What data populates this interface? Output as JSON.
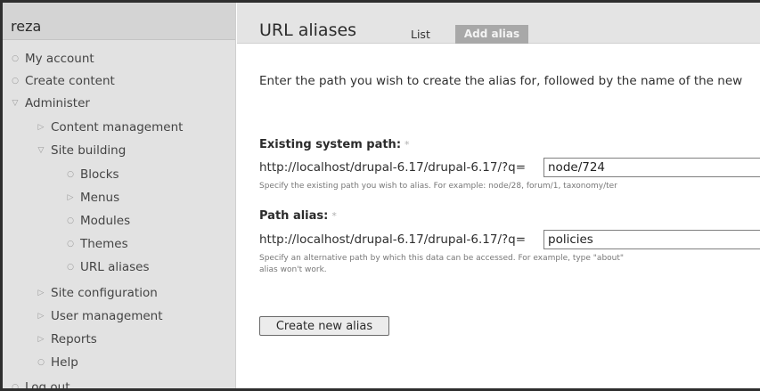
{
  "sidebar": {
    "title": "reza",
    "items": [
      {
        "label": "My account",
        "bullet": "○"
      },
      {
        "label": "Create content",
        "bullet": "○"
      },
      {
        "label": "Administer",
        "bullet": "▽"
      },
      {
        "label": "Content management",
        "bullet": "▷"
      },
      {
        "label": "Site building",
        "bullet": "▽"
      },
      {
        "label": "Blocks",
        "bullet": "○"
      },
      {
        "label": "Menus",
        "bullet": "▷"
      },
      {
        "label": "Modules",
        "bullet": "○"
      },
      {
        "label": "Themes",
        "bullet": "○"
      },
      {
        "label": "URL aliases",
        "bullet": "○"
      },
      {
        "label": "Site configuration",
        "bullet": "▷"
      },
      {
        "label": "User management",
        "bullet": "▷"
      },
      {
        "label": "Reports",
        "bullet": "▷"
      },
      {
        "label": "Help",
        "bullet": "○"
      },
      {
        "label": "Log out",
        "bullet": "○"
      }
    ]
  },
  "main": {
    "title": "URL aliases",
    "tabs": [
      {
        "label": "List"
      },
      {
        "label": "Add alias"
      }
    ],
    "intro": "Enter the path you wish to create the alias for, followed by the name of the new",
    "fields": [
      {
        "label": "Existing system path:",
        "required_mark": "*",
        "prefix": "http://localhost/drupal-6.17/drupal-6.17/?q=",
        "value": "node/724",
        "description": "Specify the existing path you wish to alias. For example: node/28, forum/1, taxonomy/ter"
      },
      {
        "label": "Path alias:",
        "required_mark": "*",
        "prefix": "http://localhost/drupal-6.17/drupal-6.17/?q=",
        "value": "policies",
        "description": "Specify an alternative path by which this data can be accessed. For example, type \"about\"",
        "description2": "alias won't work."
      }
    ],
    "submit_label": "Create new alias"
  }
}
